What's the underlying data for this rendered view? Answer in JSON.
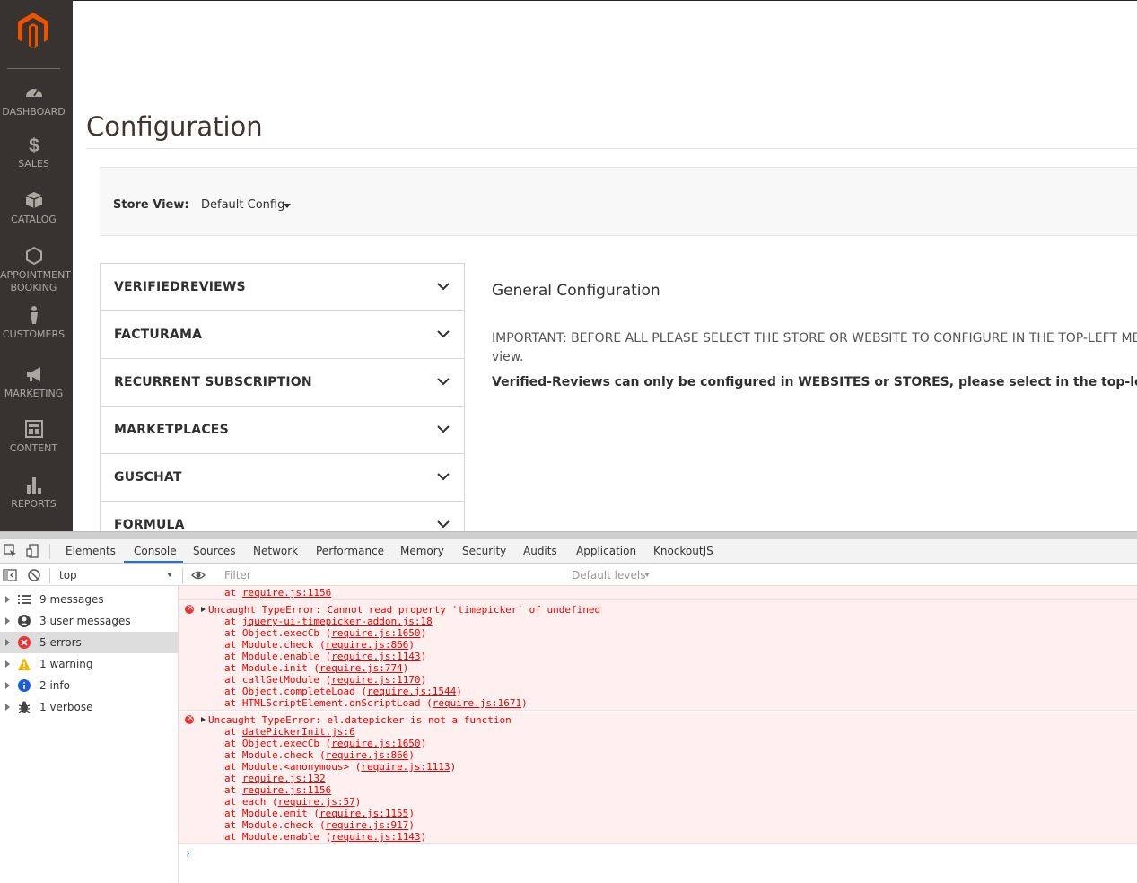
{
  "sidebar": {
    "items": [
      {
        "label": "DASHBOARD",
        "icon": "dashboard-icon"
      },
      {
        "label": "SALES",
        "icon": "dollar-icon"
      },
      {
        "label": "CATALOG",
        "icon": "box-icon"
      },
      {
        "label": "APPOINTMENT BOOKING",
        "icon": "hexagon-icon"
      },
      {
        "label": "CUSTOMERS",
        "icon": "person-icon"
      },
      {
        "label": "MARKETING",
        "icon": "megaphone-icon"
      },
      {
        "label": "CONTENT",
        "icon": "layout-icon"
      },
      {
        "label": "REPORTS",
        "icon": "bar-chart-icon"
      }
    ]
  },
  "page": {
    "title": "Configuration",
    "store_view_label": "Store View:",
    "store_view_value": "Default Config",
    "config_tabs": [
      "VERIFIEDREVIEWS",
      "FACTURAMA",
      "RECURRENT SUBSCRIPTION",
      "MARKETPLACES",
      "GUSCHAT",
      "FORMULA"
    ],
    "section_heading": "General Configuration",
    "important_note": "IMPORTANT: BEFORE ALL PLEASE SELECT THE STORE OR WEBSITE TO CONFIGURE IN THE TOP-LEFT MENU. You",
    "important_note_line2": "view.",
    "bold_note": "Verified-Reviews can only be configured in WEBSITES or STORES, please select in the top-left menu the w"
  },
  "devtools": {
    "tabs": [
      "Elements",
      "Console",
      "Sources",
      "Network",
      "Performance",
      "Memory",
      "Security",
      "Audits",
      "Application",
      "KnockoutJS"
    ],
    "active_tab": "Console",
    "context": "top",
    "filter_placeholder": "Filter",
    "levels": "Default levels",
    "sidebar": [
      {
        "label": "9 messages",
        "icon": "list-icon"
      },
      {
        "label": "3 user messages",
        "icon": "user-icon"
      },
      {
        "label": "5 errors",
        "icon": "error-icon"
      },
      {
        "label": "1 warning",
        "icon": "warning-icon"
      },
      {
        "label": "2 info",
        "icon": "info-icon"
      },
      {
        "label": "1 verbose",
        "icon": "bug-icon"
      }
    ],
    "selected_sidebar": "5 errors",
    "messages": [
      {
        "lines": [
          {
            "pre": "at ",
            "link": "require.js:1156",
            "post": ""
          }
        ]
      },
      {
        "title": "Uncaught TypeError: Cannot read property 'timepicker' of undefined",
        "lines": [
          {
            "pre": "at ",
            "link": "jquery-ui-timepicker-addon.js:18",
            "post": ""
          },
          {
            "pre": "at Object.execCb (",
            "link": "require.js:1650",
            "post": ")"
          },
          {
            "pre": "at Module.check (",
            "link": "require.js:866",
            "post": ")"
          },
          {
            "pre": "at Module.enable (",
            "link": "require.js:1143",
            "post": ")"
          },
          {
            "pre": "at Module.init (",
            "link": "require.js:774",
            "post": ")"
          },
          {
            "pre": "at callGetModule (",
            "link": "require.js:1170",
            "post": ")"
          },
          {
            "pre": "at Object.completeLoad (",
            "link": "require.js:1544",
            "post": ")"
          },
          {
            "pre": "at HTMLScriptElement.onScriptLoad (",
            "link": "require.js:1671",
            "post": ")"
          }
        ]
      },
      {
        "title": "Uncaught TypeError: el.datepicker is not a function",
        "lines": [
          {
            "pre": "at ",
            "link": "datePickerInit.js:6",
            "post": ""
          },
          {
            "pre": "at Object.execCb (",
            "link": "require.js:1650",
            "post": ")"
          },
          {
            "pre": "at Module.check (",
            "link": "require.js:866",
            "post": ")"
          },
          {
            "pre": "at Module.<anonymous> (",
            "link": "require.js:1113",
            "post": ")"
          },
          {
            "pre": "at ",
            "link": "require.js:132",
            "post": ""
          },
          {
            "pre": "at ",
            "link": "require.js:1156",
            "post": ""
          },
          {
            "pre": "at each (",
            "link": "require.js:57",
            "post": ")"
          },
          {
            "pre": "at Module.emit (",
            "link": "require.js:1155",
            "post": ")"
          },
          {
            "pre": "at Module.check (",
            "link": "require.js:917",
            "post": ")"
          },
          {
            "pre": "at Module.enable (",
            "link": "require.js:1143",
            "post": ")"
          }
        ]
      }
    ],
    "prompt": "›"
  },
  "colors": {
    "sidebar_bg": "#373330",
    "logo_orange": "#eb5202",
    "error_red": "#e00000",
    "error_bg": "#fff0f0",
    "active_tab_accent": "#1a73e8"
  }
}
